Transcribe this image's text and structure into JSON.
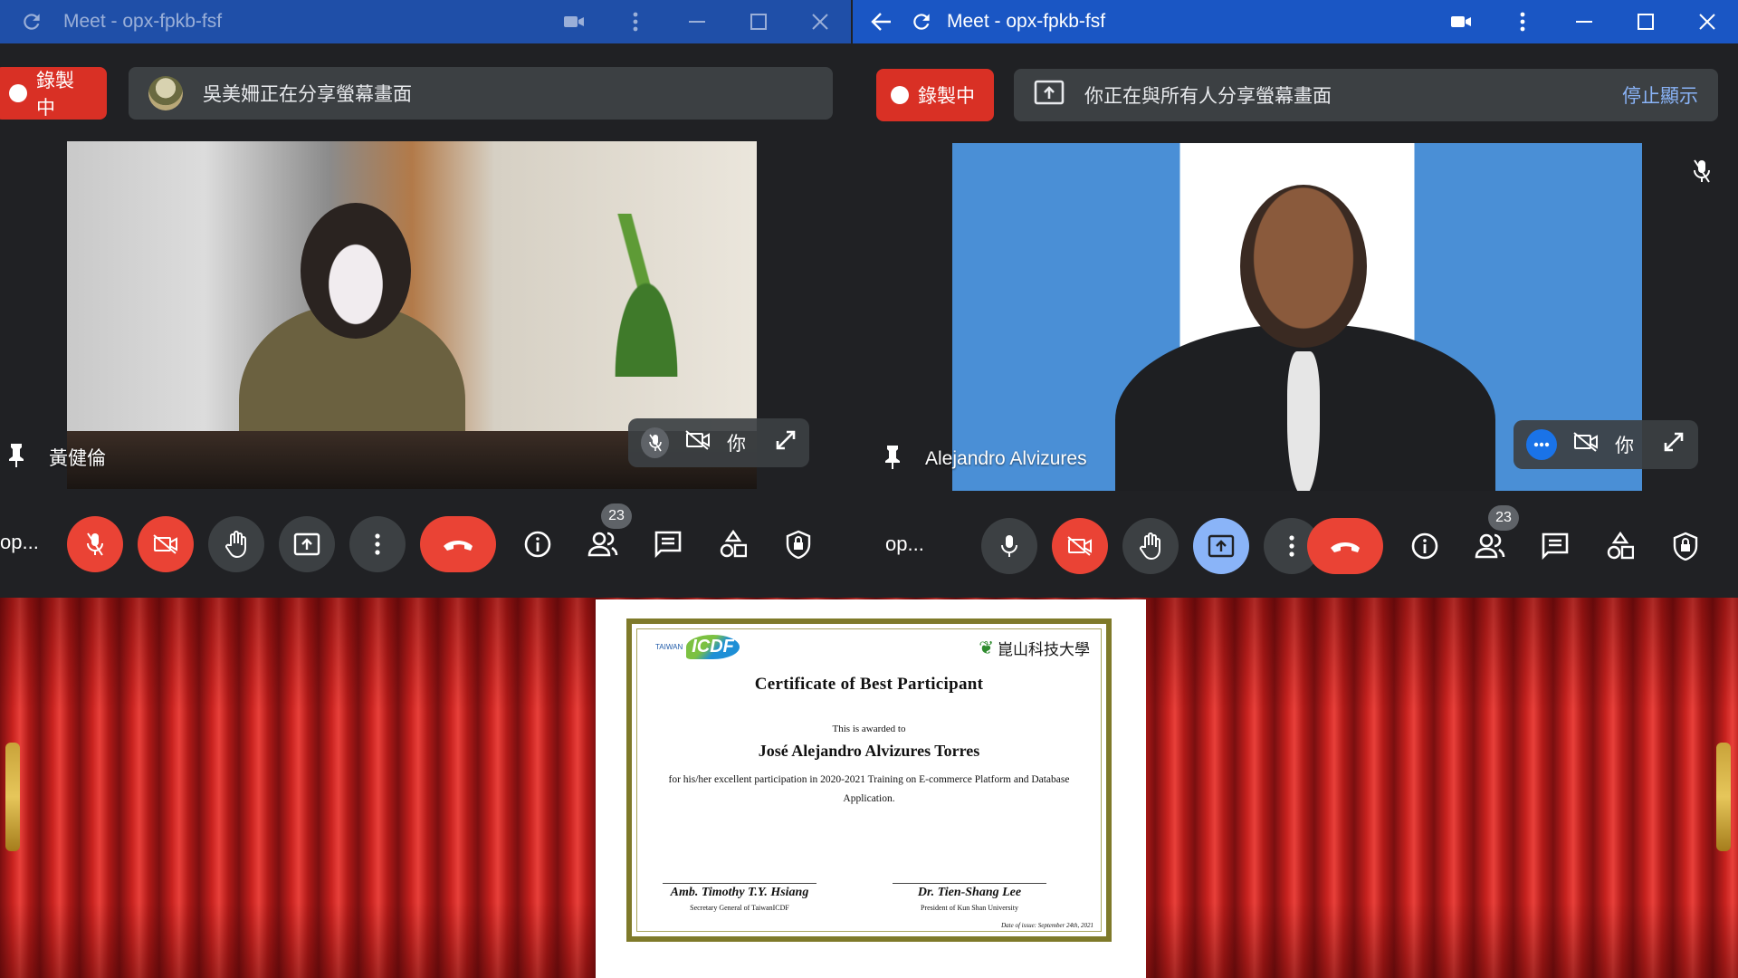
{
  "left_window": {
    "title": "Meet - opx-fpkb-fsf",
    "recording_label": "錄製中",
    "presenting_banner": "吳美姍正在分享螢幕畫面",
    "tile_name": "黃健倫",
    "tile_you_label": "你",
    "meeting_code_short": "op...",
    "participant_count": "23"
  },
  "right_window": {
    "title": "Meet - opx-fpkb-fsf",
    "recording_label": "錄製中",
    "presenting_banner": "你正在與所有人分享螢幕畫面",
    "stop_presenting": "停止顯示",
    "tile_name": "Alejandro Alvizures",
    "tile_you_label": "你",
    "meeting_code_short": "op...",
    "participant_count": "23"
  },
  "certificate": {
    "logo_left_small": "TAIWAN",
    "logo_left": "ICDF",
    "logo_right": "崑山科技大學",
    "title": "Certificate of Best Participant",
    "awarded_line": "This is awarded to",
    "recipient": "José Alejandro Alvizures Torres",
    "body": "for his/her excellent participation in 2020-2021 Training on E-commerce Platform and Database Application.",
    "signer1_name": "Amb. Timothy T.Y. Hsiang",
    "signer1_title": "Secretary General of TaiwanICDF",
    "signer2_name": "Dr. Tien-Shang Lee",
    "signer2_title": "President of Kun Shan University",
    "date_of_issue": "Date of issue: September 24th, 2021"
  },
  "colors": {
    "titlebar_blue": "#1a56c4",
    "meet_dark": "#202124",
    "control_grey": "#3c4043",
    "danger_red": "#ea4335",
    "active_blue": "#8ab4f8",
    "curtain_red": "#c8221f"
  },
  "icons": [
    "back-icon",
    "refresh-icon",
    "camera-icon",
    "kebab-icon",
    "minimize-icon",
    "maximize-icon",
    "close-icon",
    "pin-icon",
    "mic-off-icon",
    "camera-off-icon",
    "expand-icon",
    "hand-icon",
    "present-icon",
    "hangup-icon",
    "info-icon",
    "people-icon",
    "chat-icon",
    "activities-icon",
    "host-controls-icon"
  ]
}
